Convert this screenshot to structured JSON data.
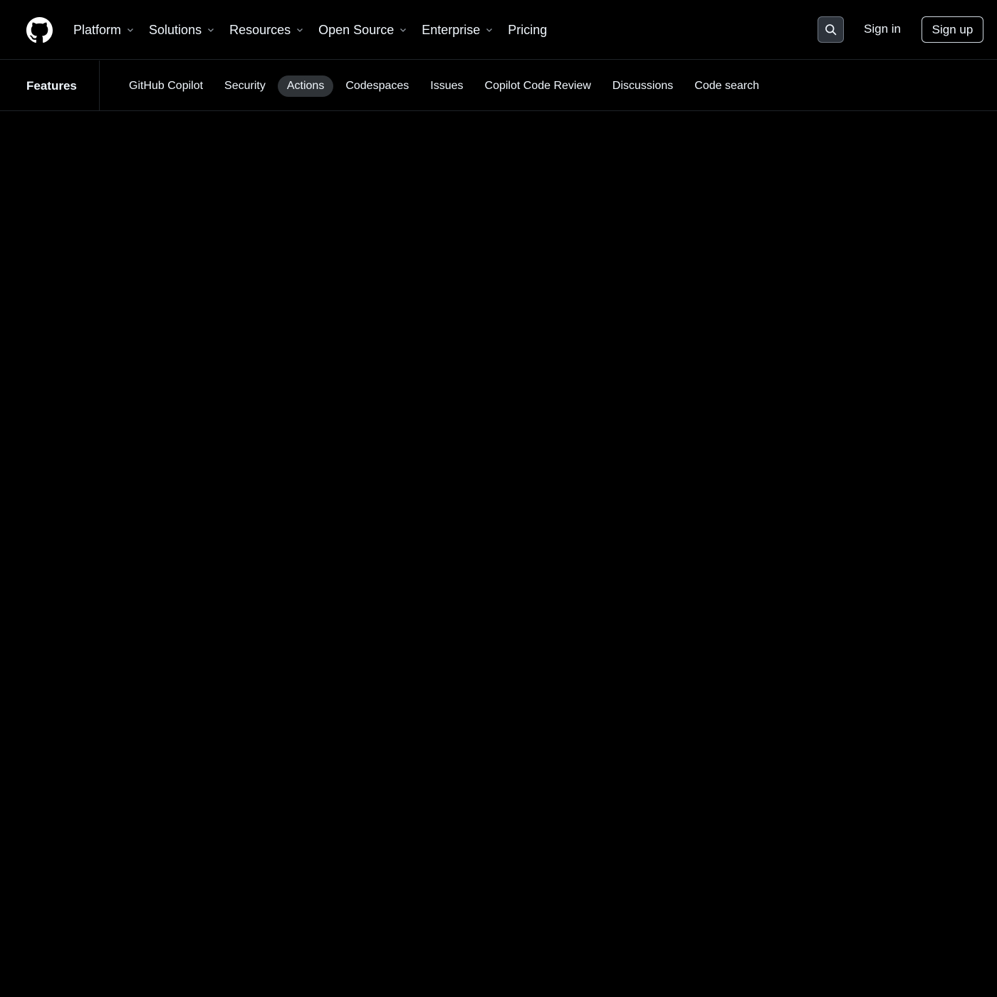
{
  "header": {
    "nav": [
      {
        "label": "Platform",
        "has_dropdown": true
      },
      {
        "label": "Solutions",
        "has_dropdown": true
      },
      {
        "label": "Resources",
        "has_dropdown": true
      },
      {
        "label": "Open Source",
        "has_dropdown": true
      },
      {
        "label": "Enterprise",
        "has_dropdown": true
      },
      {
        "label": "Pricing",
        "has_dropdown": false
      }
    ],
    "search_icon": "search-icon",
    "sign_in": "Sign in",
    "sign_up": "Sign up"
  },
  "subnav": {
    "title": "Features",
    "links": [
      {
        "label": "GitHub Copilot",
        "active": false
      },
      {
        "label": "Security",
        "active": false
      },
      {
        "label": "Actions",
        "active": true
      },
      {
        "label": "Codespaces",
        "active": false
      },
      {
        "label": "Issues",
        "active": false
      },
      {
        "label": "Copilot Code Review",
        "active": false
      },
      {
        "label": "Discussions",
        "active": false
      },
      {
        "label": "Code search",
        "active": false
      }
    ]
  },
  "colors": {
    "background": "#000000",
    "text": "#f0f6fc",
    "active_pill": "#2f3337",
    "border": "#1f2328"
  }
}
